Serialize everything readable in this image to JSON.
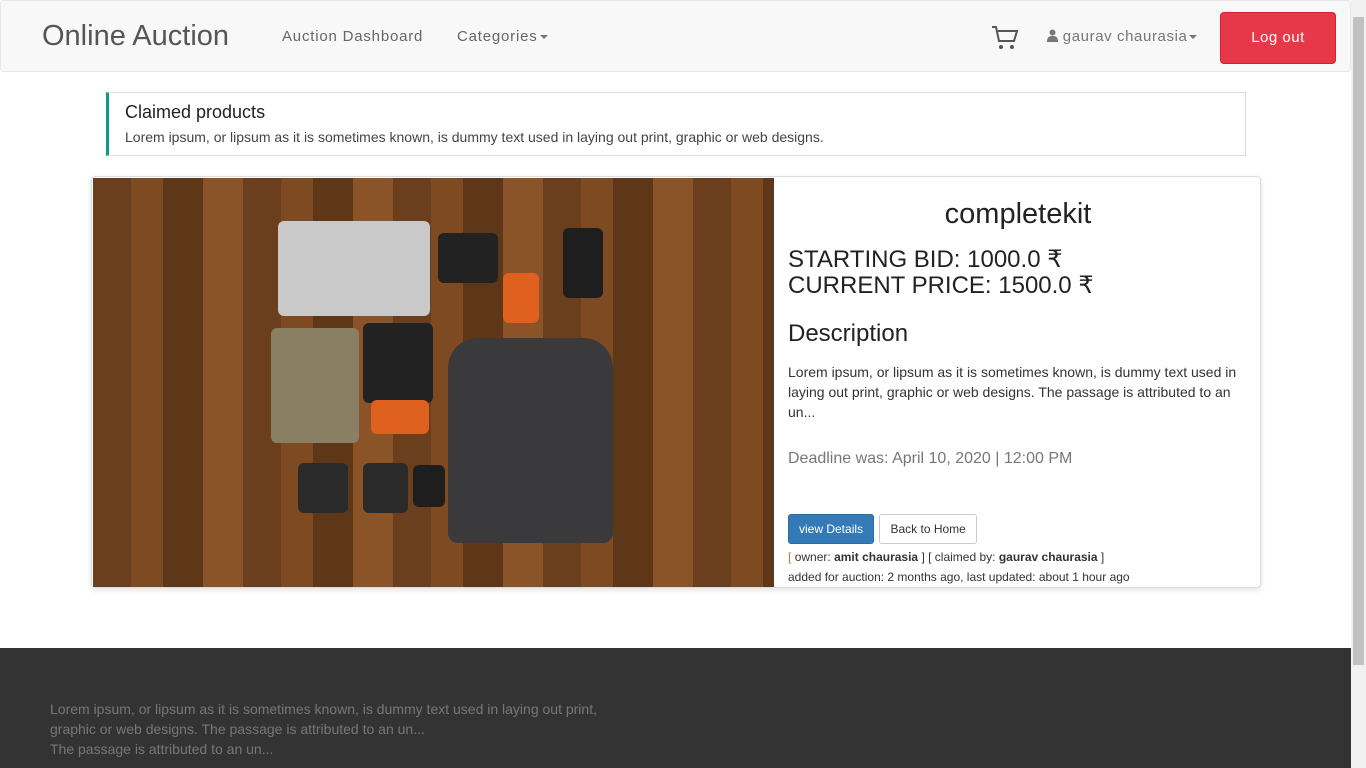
{
  "nav": {
    "brand": "Online Auction",
    "links": [
      "Auction Dashboard",
      "Categories"
    ],
    "user": "gaurav chaurasia",
    "logout": "Log out",
    "cart_icon": "shopping-cart-icon",
    "user_icon": "user-icon",
    "logout_color": "#e63848"
  },
  "callout": {
    "title": "Claimed products",
    "text": "Lorem ipsum, or lipsum as it is sometimes known, is dummy text used in laying out print, graphic or web designs.",
    "accent": "#0a9b8f"
  },
  "product": {
    "name": "completekit",
    "starting_bid": "STARTING BID: 1000.0 ₹",
    "current_price": "CURRENT PRICE: 1500.0 ₹",
    "description_heading": "Description",
    "description": "Lorem ipsum, or lipsum as it is sometimes known, is dummy text used in laying out print, graphic or web designs. The passage is attributed to an un...",
    "deadline": "Deadline was: April 10, 2020 | 12:00 PM",
    "view_button": "view Details",
    "back_button": "Back to Home",
    "owner_label": "owner:",
    "owner": "amit chaurasia",
    "claimed_label": "claimed by:",
    "claimed_by": "gaurav chaurasia",
    "timestamps": "added for auction: 2 months ago, last updated: about 1 hour ago"
  },
  "footer": {
    "line1": "Lorem ipsum, or lipsum as it is sometimes known, is dummy text used in laying out print, graphic or web designs. The passage is attributed to an un...",
    "line2": "The passage is attributed to an un..."
  }
}
